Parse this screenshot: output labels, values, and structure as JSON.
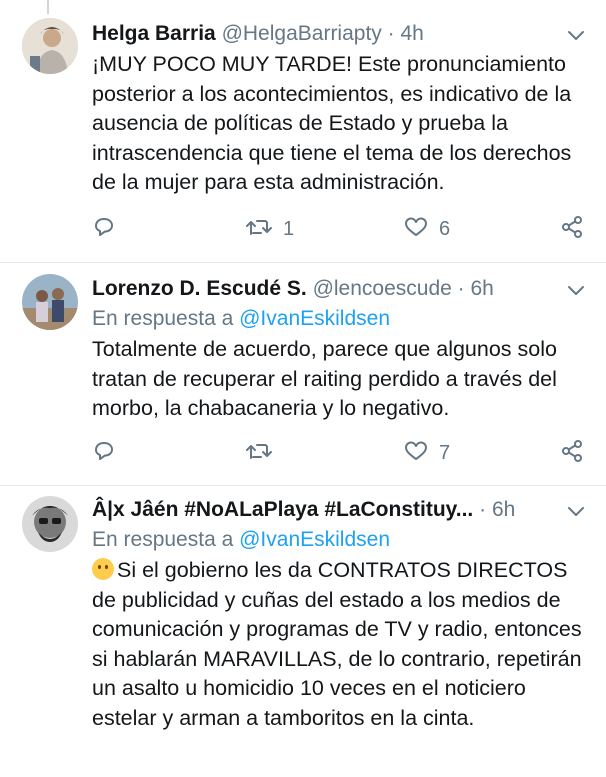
{
  "tweets": [
    {
      "name": "Helga Barria",
      "handle": "@HelgaBarriapty",
      "dot": "·",
      "time": "4h",
      "reply_prefix": "",
      "reply_mention": "",
      "text": "¡MUY POCO MUY TARDE! Este pronunciamiento posterior a los acontecimientos, es indicativo de la ausencia de políticas de Estado y prueba la intrascendencia que tiene el tema de los derechos de la mujer  para esta administración.",
      "retweets": "1",
      "likes": "6"
    },
    {
      "name": "Lorenzo D. Escudé S.",
      "handle": "@lencoescude",
      "dot": "·",
      "time": "6h",
      "reply_prefix": "En respuesta a",
      "reply_mention": "@IvanEskildsen",
      "text": "Totalmente de acuerdo, parece que algunos solo tratan de recuperar el raiting perdido a través del morbo, la chabacaneria y lo negativo.",
      "retweets": "",
      "likes": "7"
    },
    {
      "name": "Â|x Jâén #NoALaPlaya #LaConstituy...",
      "handle": "",
      "dot": "·",
      "time": "6h",
      "reply_prefix": "En respuesta a",
      "reply_mention": "@IvanEskildsen",
      "text": "Si el gobierno les da CONTRATOS DIRECTOS de publicidad y cuñas del estado a los medios de comunicación y programas de TV y radio, entonces si hablarán MARAVILLAS, de lo contrario, repetirán un asalto u homicidio 10 veces en el noticiero estelar y arman a tamboritos en la cinta.",
      "emoji": "thinking-face-icon"
    }
  ],
  "colors": {
    "text": "#14171a",
    "secondary": "#657786",
    "link": "#1da1f2",
    "divider": "#e1e8ed"
  }
}
